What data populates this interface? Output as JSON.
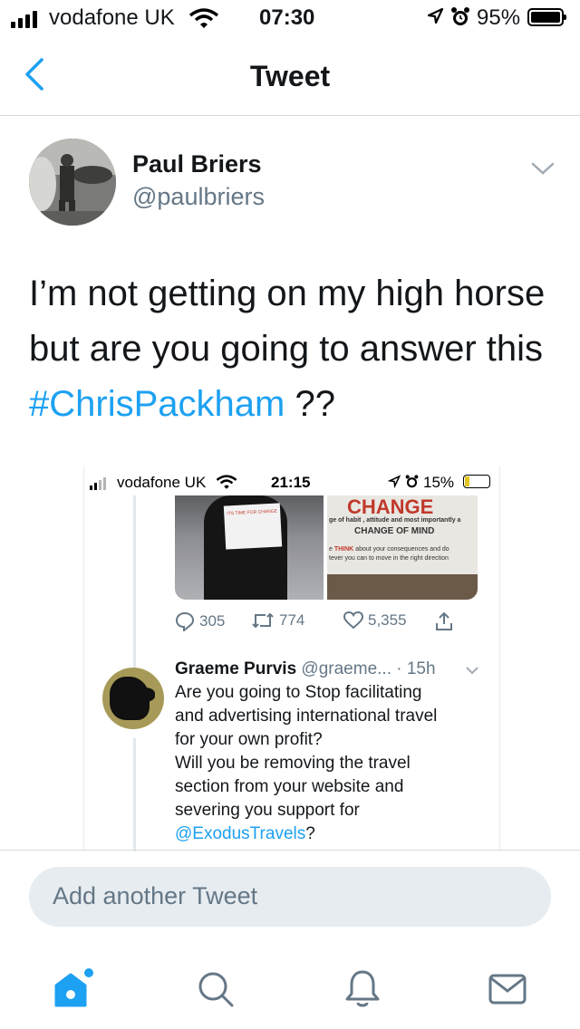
{
  "status_bar": {
    "carrier": "vodafone UK",
    "time": "07:30",
    "battery_percent": "95%",
    "icons": [
      "signal-icon",
      "wifi-icon",
      "location-icon",
      "alarm-icon",
      "battery-icon"
    ]
  },
  "nav": {
    "title": "Tweet",
    "back_icon": "chevron-left-icon"
  },
  "tweet": {
    "author_name": "Paul Briers",
    "author_handle": "@paulbriers",
    "text_line1": "I’m not getting on my high horse",
    "text_line2": "but are you going to answer this",
    "hashtag": "#ChrisPackham",
    "text_suffix": " ??"
  },
  "embedded_screenshot": {
    "status_bar": {
      "carrier": "vodafone UK",
      "time": "21:15",
      "battery_percent": "15%"
    },
    "photo_text": {
      "sign_text": "ITS TIME FOR CHANGE",
      "change": "CHANGE",
      "line1": "ge of habit , attitude and most importantly a",
      "line2": "CHANGE OF MIND",
      "think_prefix": "e ",
      "think": "THINK",
      "line3_rest": " about your consequences and do",
      "line4": "tever you can to move in the right direction"
    },
    "actions": {
      "replies": "305",
      "retweets": "774",
      "likes": "5,355"
    },
    "reply": {
      "name": "Graeme Purvis",
      "handle_time": "@graeme... · 15h",
      "line1": "Are you going to Stop facilitating",
      "line2": "and advertising international travel",
      "line3": "for your own profit?",
      "line4": "Will you be removing the travel",
      "line5": "section from your website and",
      "line6": "severing you support for",
      "mention": "@ExodusTravels",
      "end": "?"
    }
  },
  "reply_bar": {
    "placeholder": "Add another Tweet"
  },
  "tab_bar": {
    "items": [
      "home-icon",
      "search-icon",
      "notifications-icon",
      "messages-icon"
    ]
  },
  "colors": {
    "accent": "#1da1f2",
    "secondary_text": "#657786",
    "input_bg": "#e6ecf0"
  }
}
